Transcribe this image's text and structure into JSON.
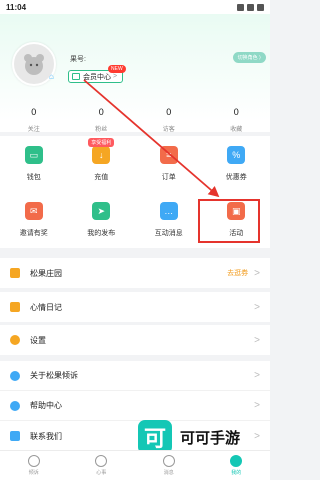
{
  "status_bar": {
    "time": "11:04"
  },
  "profile": {
    "id_label": "果号:",
    "vip_label": "会员中心",
    "vip_arrow": ">",
    "new_badge": "NEW",
    "top_pill": "切换角色 ⟩"
  },
  "stats": [
    {
      "num": "0",
      "label": "关注"
    },
    {
      "num": "0",
      "label": "粉丝"
    },
    {
      "num": "0",
      "label": "访客"
    },
    {
      "num": "0",
      "label": "收藏"
    }
  ],
  "grid": {
    "row1": [
      {
        "label": "钱包",
        "color": "#2fbf8a",
        "glyph": "▭"
      },
      {
        "label": "充值",
        "color": "#f5a623",
        "glyph": "↓",
        "badge": "享受福利"
      },
      {
        "label": "订单",
        "color": "#f26b4a",
        "glyph": "≡"
      },
      {
        "label": "优惠券",
        "color": "#3fa9f5",
        "glyph": "%"
      }
    ],
    "row2": [
      {
        "label": "邀请有奖",
        "color": "#f26b4a",
        "glyph": "✉"
      },
      {
        "label": "我的发布",
        "color": "#2fbf8a",
        "glyph": "➤"
      },
      {
        "label": "互动消息",
        "color": "#3fa9f5",
        "glyph": "…"
      },
      {
        "label": "活动",
        "color": "#f26b4a",
        "glyph": "▣"
      }
    ]
  },
  "list": {
    "farm": {
      "label": "松果庄园",
      "extra": "去逛券",
      "color": "#f5a623"
    },
    "diary": {
      "label": "心情日记",
      "color": "#f5a623"
    },
    "settings": {
      "label": "设置",
      "color": "#f5a623"
    },
    "about": {
      "label": "关于松果倾诉",
      "color": "#3fa9f5"
    },
    "help": {
      "label": "帮助中心",
      "color": "#3fa9f5"
    },
    "contact": {
      "label": "联系我们",
      "color": "#3fa9f5"
    }
  },
  "chevron": ">",
  "watermark": {
    "logo": "可",
    "text": "可可手游"
  },
  "tabs": [
    {
      "label": "倾诉"
    },
    {
      "label": "心事"
    },
    {
      "label": "消息"
    },
    {
      "label": "我的"
    }
  ],
  "colors": {
    "accent": "#14c7b5",
    "highlight": "#e5342d"
  }
}
